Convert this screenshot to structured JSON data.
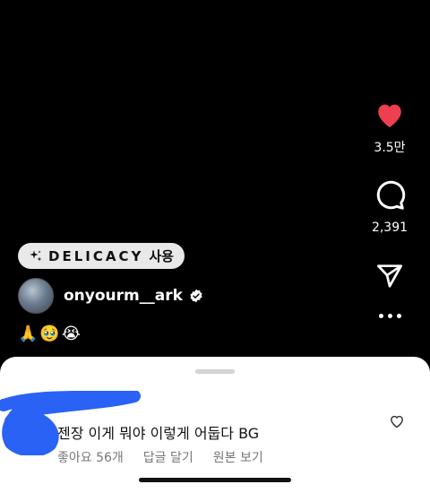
{
  "reel": {
    "like_count": "3.5만",
    "comment_count": "2,391",
    "effect": {
      "name": "DELICACY",
      "suffix": "사용",
      "icon": "sparkle-icon"
    },
    "author": {
      "username": "onyourm__ark",
      "verified": true
    },
    "caption_emojis": "🙏🥹😭"
  },
  "comments_sheet": {
    "comment": {
      "text": "젠장 이게 뭐야 이렇게 어둡다 BG",
      "likes_label": "좋아요 56개",
      "reply_label": "답글 달기",
      "original_label": "원본 보기"
    }
  },
  "colors": {
    "like_red": "#ed3f4f",
    "scribble_blue": "#2a62f5",
    "sheet_bg": "#ffffff"
  }
}
